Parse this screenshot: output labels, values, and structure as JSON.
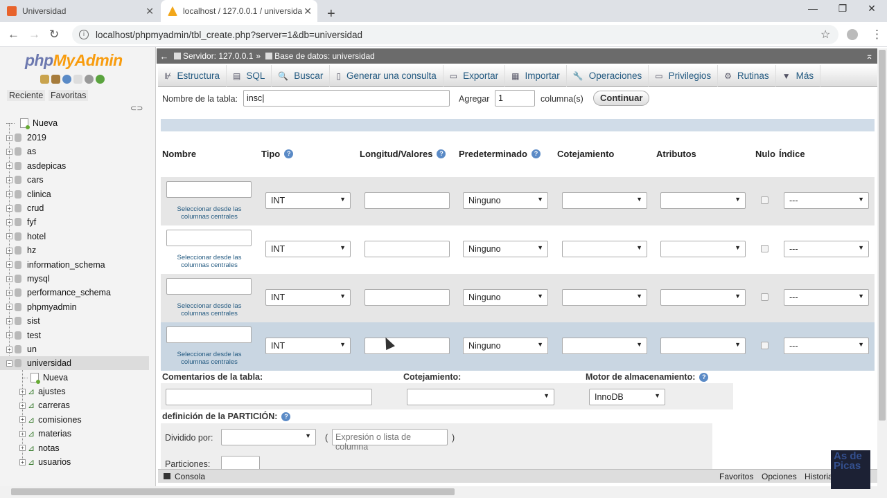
{
  "browser": {
    "tabs": [
      {
        "title": "Universidad"
      },
      {
        "title": "localhost / 127.0.0.1 / universida"
      }
    ],
    "url": "localhost/phpmyadmin/tbl_create.php?server=1&db=universidad"
  },
  "sidebar": {
    "logo_a": "php",
    "logo_b": "MyAdmin",
    "recent": "Reciente",
    "favorites": "Favoritas",
    "new": "Nueva",
    "databases": [
      "2019",
      "as",
      "asdepicas",
      "cars",
      "clinica",
      "crud",
      "fyf",
      "hotel",
      "hz",
      "information_schema",
      "mysql",
      "performance_schema",
      "phpmyadmin",
      "sist",
      "test",
      "un",
      "universidad"
    ],
    "db_new": "Nueva",
    "tables": [
      "ajustes",
      "carreras",
      "comisiones",
      "materias",
      "notas",
      "usuarios"
    ]
  },
  "breadcrumb": {
    "server": "Servidor: 127.0.0.1",
    "sep": "»",
    "database": "Base de datos: universidad"
  },
  "menu": [
    "Estructura",
    "SQL",
    "Buscar",
    "Generar una consulta",
    "Exportar",
    "Importar",
    "Operaciones",
    "Privilegios",
    "Rutinas",
    "Más"
  ],
  "form": {
    "table_name_label": "Nombre de la tabla:",
    "table_name_value": "insc",
    "add_label": "Agregar",
    "add_value": "1",
    "columns_label": "columna(s)",
    "continue": "Continuar"
  },
  "columns_header": [
    "Nombre",
    "Tipo",
    "Longitud/Valores",
    "Predeterminado",
    "Cotejamiento",
    "Atributos",
    "Nulo",
    "Índice"
  ],
  "rows": [
    {
      "central": "Seleccionar desde las columnas centrales",
      "type": "INT",
      "default": "Ninguno",
      "index": "---"
    },
    {
      "central": "Seleccionar desde las columnas centrales",
      "type": "INT",
      "default": "Ninguno",
      "index": "---"
    },
    {
      "central": "Seleccionar desde las columnas centrales",
      "type": "INT",
      "default": "Ninguno",
      "index": "---"
    },
    {
      "central": "Seleccionar desde las columnas centrales",
      "type": "INT",
      "default": "Ninguno",
      "index": "---"
    }
  ],
  "table_options": {
    "comments_label": "Comentarios de la tabla:",
    "collation_label": "Cotejamiento:",
    "engine_label": "Motor de almacenamiento:",
    "engine_value": "InnoDB"
  },
  "partition": {
    "title": "definición de la PARTICIÓN:",
    "divided_label": "Dividido por:",
    "paren_open": "(",
    "paren_close": ")",
    "expression_placeholder": "Expresión o lista de columna",
    "partitions_label": "Particiones:"
  },
  "console": {
    "label": "Consola",
    "favorites": "Favoritos",
    "options": "Opciones",
    "history": "Historial"
  },
  "watermark": "As de Picas"
}
